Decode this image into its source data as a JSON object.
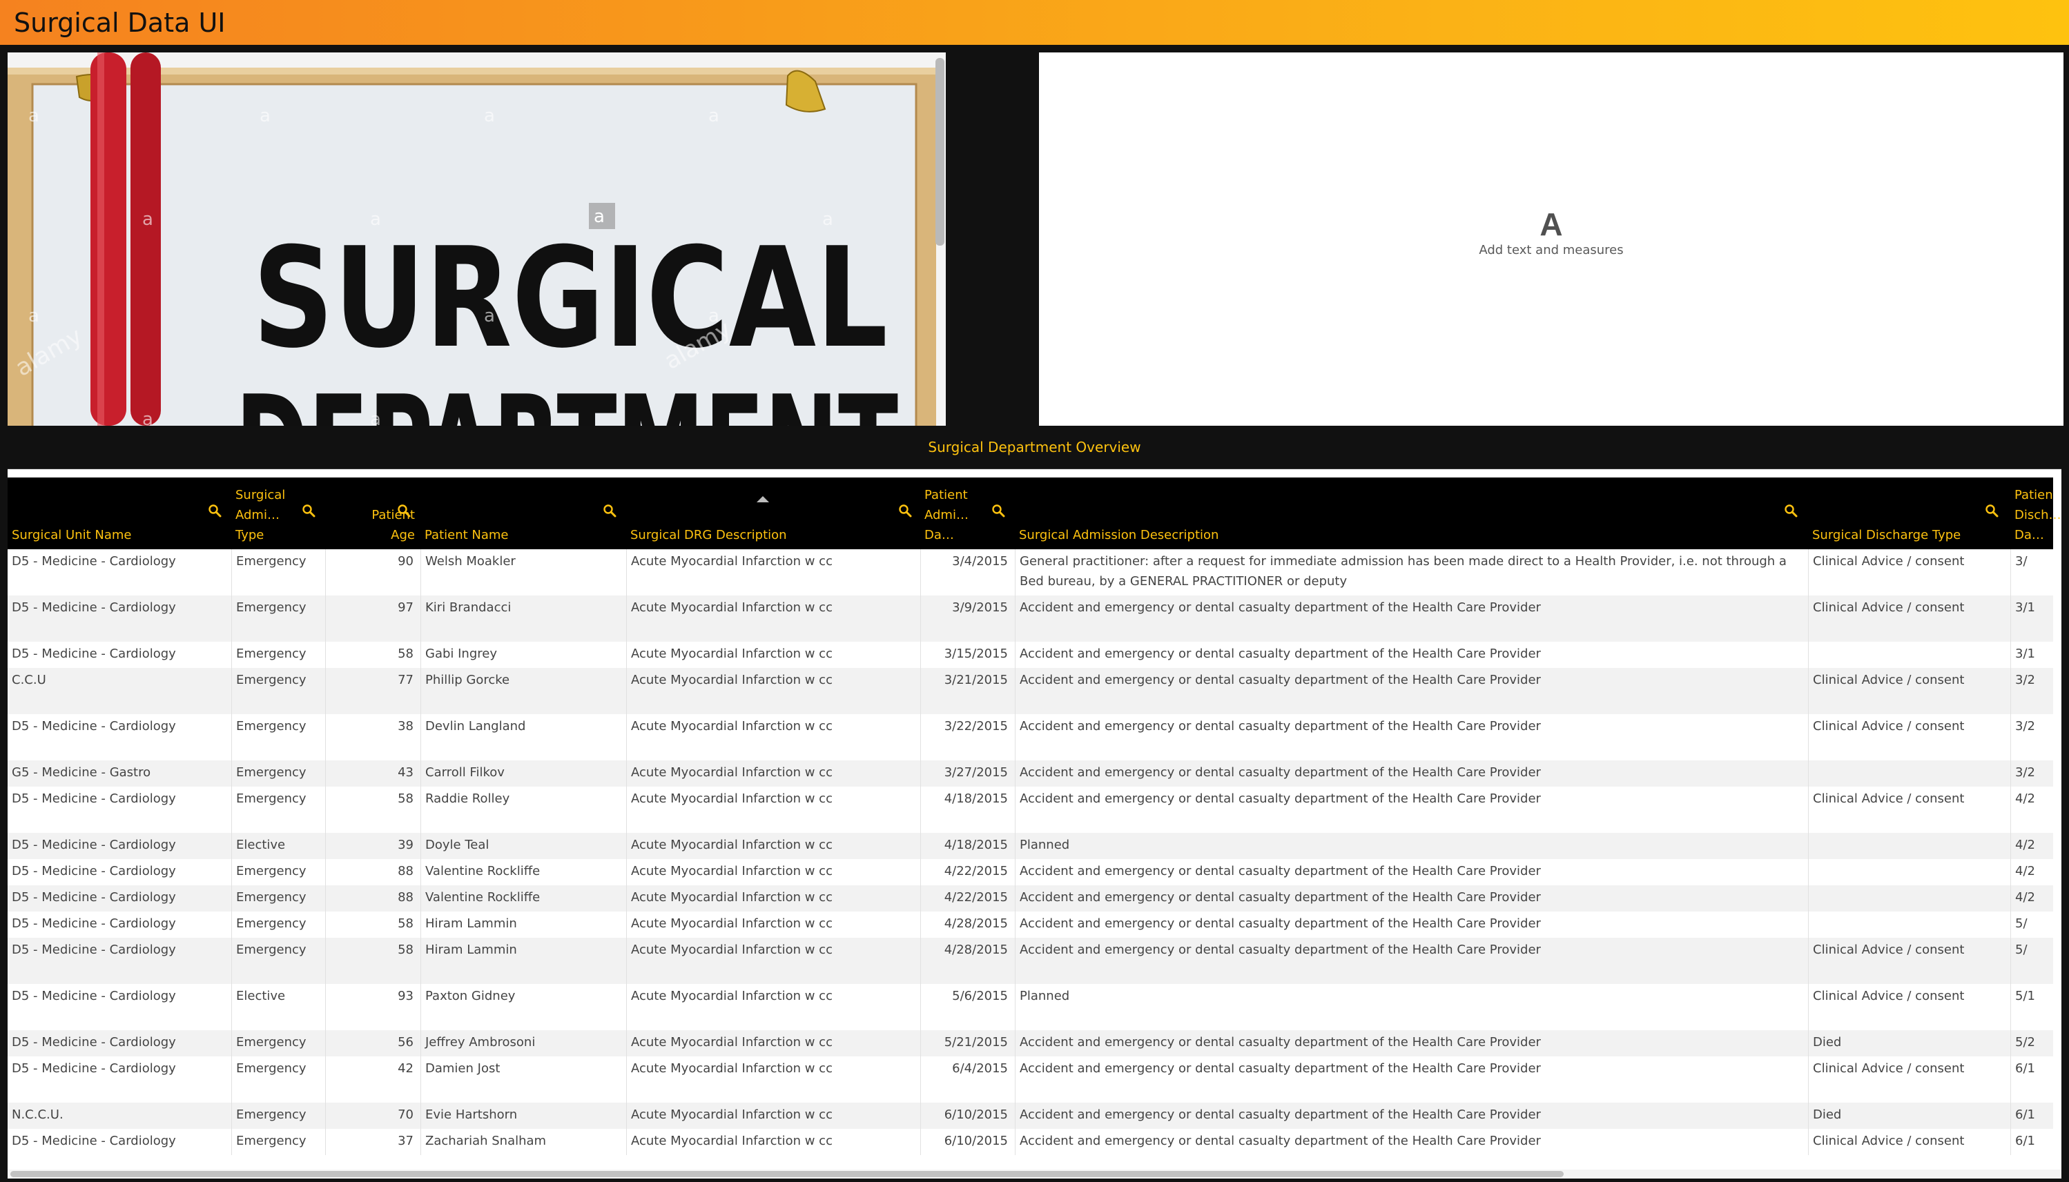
{
  "app": {
    "title": "Surgical Data UI"
  },
  "image_panel": {
    "sign_text": "SURGICAL",
    "watermark": "alamy"
  },
  "measure_panel": {
    "icon": "text-A-icon",
    "label": "Add text and measures"
  },
  "table": {
    "title": "Surgical Department Overview",
    "columns": [
      {
        "label": "Surgical Unit Name",
        "lines": [
          "Surgical Unit Name"
        ]
      },
      {
        "label": "Surgical Admi… Type",
        "lines": [
          "Surgical",
          "Admi…",
          "Type"
        ]
      },
      {
        "label": "Patient Age",
        "lines": [
          "Patient",
          "Age"
        ]
      },
      {
        "label": "Patient Name",
        "lines": [
          "Patient Name"
        ]
      },
      {
        "label": "Surgical DRG Description",
        "lines": [
          "Surgical DRG Description"
        ]
      },
      {
        "label": "Patient Admi… Da…",
        "lines": [
          "Patient",
          "Admi…",
          "Da…"
        ]
      },
      {
        "label": "Surgical Admission Desecription",
        "lines": [
          "Surgical Admission Desecription"
        ]
      },
      {
        "label": "Surgical Discharge Type",
        "lines": [
          "Surgical Discharge Type"
        ]
      },
      {
        "label": "Patien Disch… Da…",
        "lines": [
          "Patien",
          "Disch…",
          "Da…"
        ]
      }
    ],
    "rows": [
      [
        "D5 - Medicine - Cardiology",
        "Emergency",
        "90",
        "Welsh Moakler",
        "Acute Myocardial Infarction w cc",
        "3/4/2015",
        "General practitioner: after a request for immediate admission has been made direct to a Health Provider, i.e. not through a Bed bureau, by a GENERAL PRACTITIONER or deputy",
        "Clinical Advice / consent",
        "3/"
      ],
      [
        "D5 - Medicine - Cardiology",
        "Emergency",
        "97",
        "Kiri Brandacci",
        "Acute Myocardial Infarction w cc",
        "3/9/2015",
        "Accident and emergency or dental casualty department of the Health Care Provider",
        "Clinical Advice / consent",
        "3/1"
      ],
      [
        "D5 - Medicine - Cardiology",
        "Emergency",
        "58",
        "Gabi Ingrey",
        "Acute Myocardial Infarction w cc",
        "3/15/2015",
        "Accident and emergency or dental casualty department of the Health Care Provider",
        "",
        "3/1"
      ],
      [
        "C.C.U",
        "Emergency",
        "77",
        "Phillip Gorcke",
        "Acute Myocardial Infarction w cc",
        "3/21/2015",
        "Accident and emergency or dental casualty department of the Health Care Provider",
        "Clinical Advice / consent",
        "3/2"
      ],
      [
        "D5 - Medicine - Cardiology",
        "Emergency",
        "38",
        "Devlin Langland",
        "Acute Myocardial Infarction w cc",
        "3/22/2015",
        "Accident and emergency or dental casualty department of the Health Care Provider",
        "Clinical Advice / consent",
        "3/2"
      ],
      [
        "G5 - Medicine - Gastro",
        "Emergency",
        "43",
        "Carroll Filkov",
        "Acute Myocardial Infarction w cc",
        "3/27/2015",
        "Accident and emergency or dental casualty department of the Health Care Provider",
        "",
        "3/2"
      ],
      [
        "D5 - Medicine - Cardiology",
        "Emergency",
        "58",
        "Raddie Rolley",
        "Acute Myocardial Infarction w cc",
        "4/18/2015",
        "Accident and emergency or dental casualty department of the Health Care Provider",
        "Clinical Advice / consent",
        "4/2"
      ],
      [
        "D5 - Medicine - Cardiology",
        "Elective",
        "39",
        "Doyle Teal",
        "Acute Myocardial Infarction w cc",
        "4/18/2015",
        "Planned",
        "",
        "4/2"
      ],
      [
        "D5 - Medicine - Cardiology",
        "Emergency",
        "88",
        "Valentine Rockliffe",
        "Acute Myocardial Infarction w cc",
        "4/22/2015",
        "Accident and emergency or dental casualty department of the Health Care Provider",
        "",
        "4/2"
      ],
      [
        "D5 - Medicine - Cardiology",
        "Emergency",
        "88",
        "Valentine Rockliffe",
        "Acute Myocardial Infarction w cc",
        "4/22/2015",
        "Accident and emergency or dental casualty department of the Health Care Provider",
        "",
        "4/2"
      ],
      [
        "D5 - Medicine - Cardiology",
        "Emergency",
        "58",
        "Hiram Lammin",
        "Acute Myocardial Infarction w cc",
        "4/28/2015",
        "Accident and emergency or dental casualty department of the Health Care Provider",
        "",
        "5/"
      ],
      [
        "D5 - Medicine - Cardiology",
        "Emergency",
        "58",
        "Hiram Lammin",
        "Acute Myocardial Infarction w cc",
        "4/28/2015",
        "Accident and emergency or dental casualty department of the Health Care Provider",
        "Clinical Advice / consent",
        "5/"
      ],
      [
        "D5 - Medicine - Cardiology",
        "Elective",
        "93",
        "Paxton Gidney",
        "Acute Myocardial Infarction w cc",
        "5/6/2015",
        "Planned",
        "Clinical Advice / consent",
        "5/1"
      ],
      [
        "D5 - Medicine - Cardiology",
        "Emergency",
        "56",
        "Jeffrey Ambrosoni",
        "Acute Myocardial Infarction w cc",
        "5/21/2015",
        "Accident and emergency or dental casualty department of the Health Care Provider",
        "Died",
        "5/2"
      ],
      [
        "D5 - Medicine - Cardiology",
        "Emergency",
        "42",
        "Damien Jost",
        "Acute Myocardial Infarction w cc",
        "6/4/2015",
        "Accident and emergency or dental casualty department of the Health Care Provider",
        "Clinical Advice / consent",
        "6/1"
      ],
      [
        "N.C.C.U.",
        "Emergency",
        "70",
        "Evie Hartshorn",
        "Acute Myocardial Infarction w cc",
        "6/10/2015",
        "Accident and emergency or dental casualty department of the Health Care Provider",
        "Died",
        "6/1"
      ],
      [
        "D5 - Medicine - Cardiology",
        "Emergency",
        "37",
        "Zachariah Snalham",
        "Acute Myocardial Infarction w cc",
        "6/10/2015",
        "Accident and emergency or dental casualty department of the Health Care Provider",
        "Clinical Advice / consent",
        "6/1"
      ]
    ]
  }
}
